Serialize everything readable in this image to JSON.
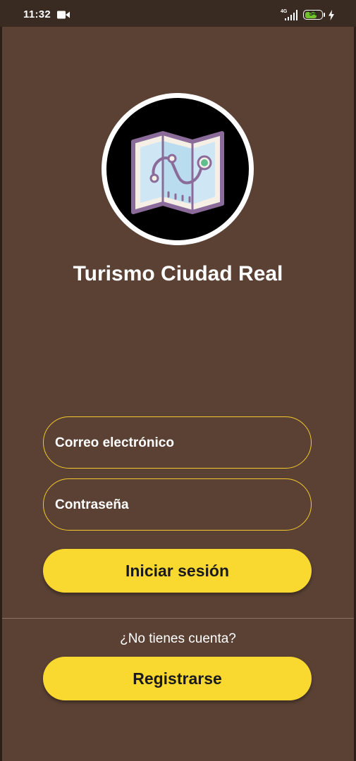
{
  "status_bar": {
    "time": "11:32",
    "network": "4G",
    "battery": "54",
    "icons": [
      "video-camera-icon",
      "signal-icon",
      "battery-icon",
      "charging-bolt-icon"
    ]
  },
  "app": {
    "title": "Turismo Ciudad Real",
    "logo_icon": "map-route-icon"
  },
  "login_form": {
    "email_placeholder": "Correo electrónico",
    "email_value": "",
    "password_placeholder": "Contraseña",
    "password_value": "",
    "login_button": "Iniciar sesión"
  },
  "register": {
    "prompt": "¿No tienes cuenta?",
    "button": "Registrarse"
  },
  "colors": {
    "background": "#5a4134",
    "status_bar": "#3a2b22",
    "accent": "#f9d930",
    "field_border": "#f3c92b",
    "battery_green": "#6fc22a"
  }
}
